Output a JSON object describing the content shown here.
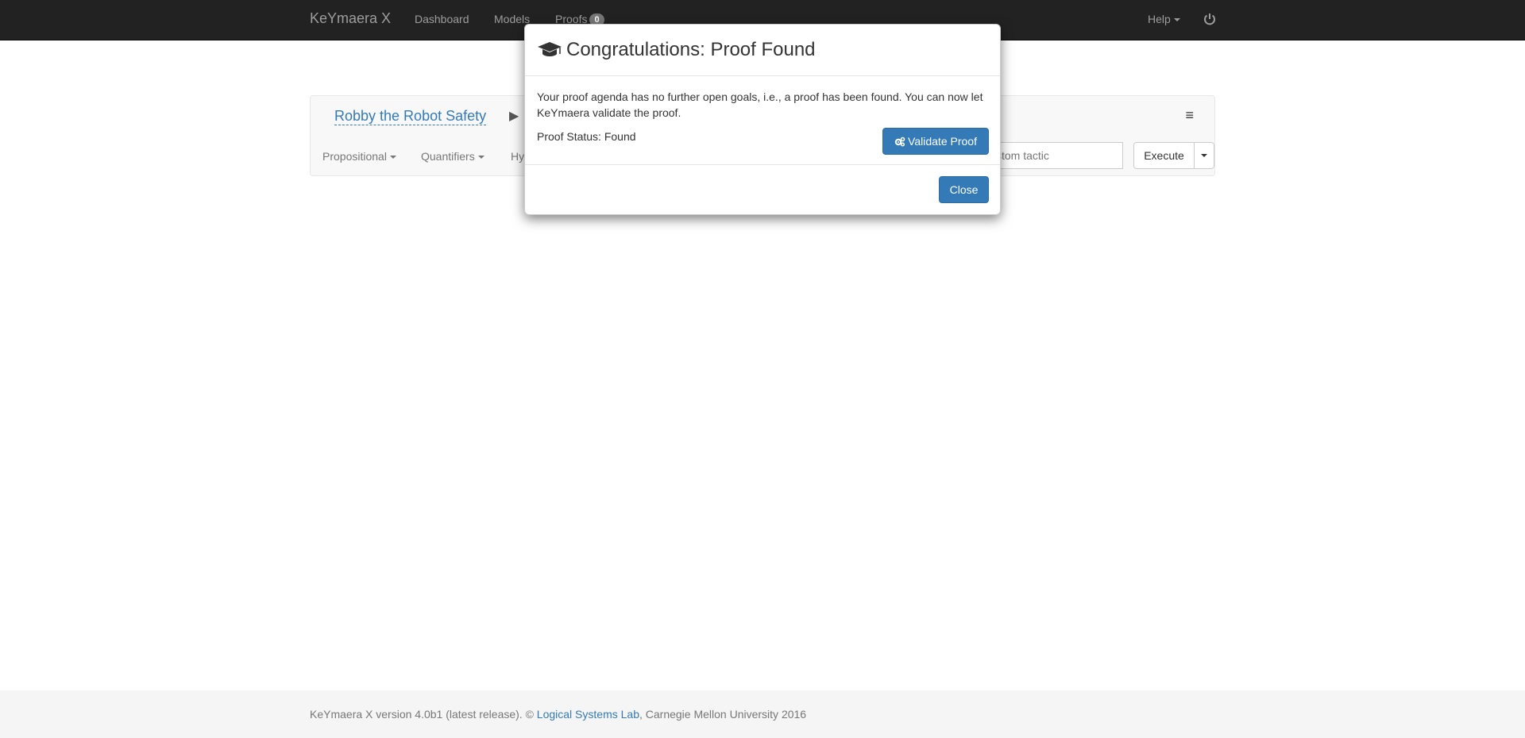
{
  "navbar": {
    "brand": "KeYmaera X",
    "links": [
      "Dashboard",
      "Models",
      "Proofs"
    ],
    "proofs_badge": "0",
    "help": "Help",
    "power_icon": "power-icon"
  },
  "proof_panel": {
    "title": "Robby the Robot Safety",
    "breadcrumb_arrow": "▶",
    "menu_icon": "≡",
    "toolbar": [
      "Propositional",
      "Quantifiers",
      "Hy"
    ],
    "tactic_placeholder": "stom tactic",
    "execute_label": "Execute"
  },
  "modal": {
    "title": "Congratulations: Proof Found",
    "message": "Your proof agenda has no further open goals, i.e., a proof has been found. You can now let KeYmaera validate the proof.",
    "status": "Proof Status: Found",
    "validate_label": "Validate Proof",
    "close_label": "Close",
    "colors": {
      "primary": "#337ab7"
    }
  },
  "footer": {
    "prefix": "KeYmaera X version 4.0b1 (latest release). © ",
    "link": "Logical Systems Lab",
    "suffix": ", Carnegie Mellon University 2016"
  }
}
